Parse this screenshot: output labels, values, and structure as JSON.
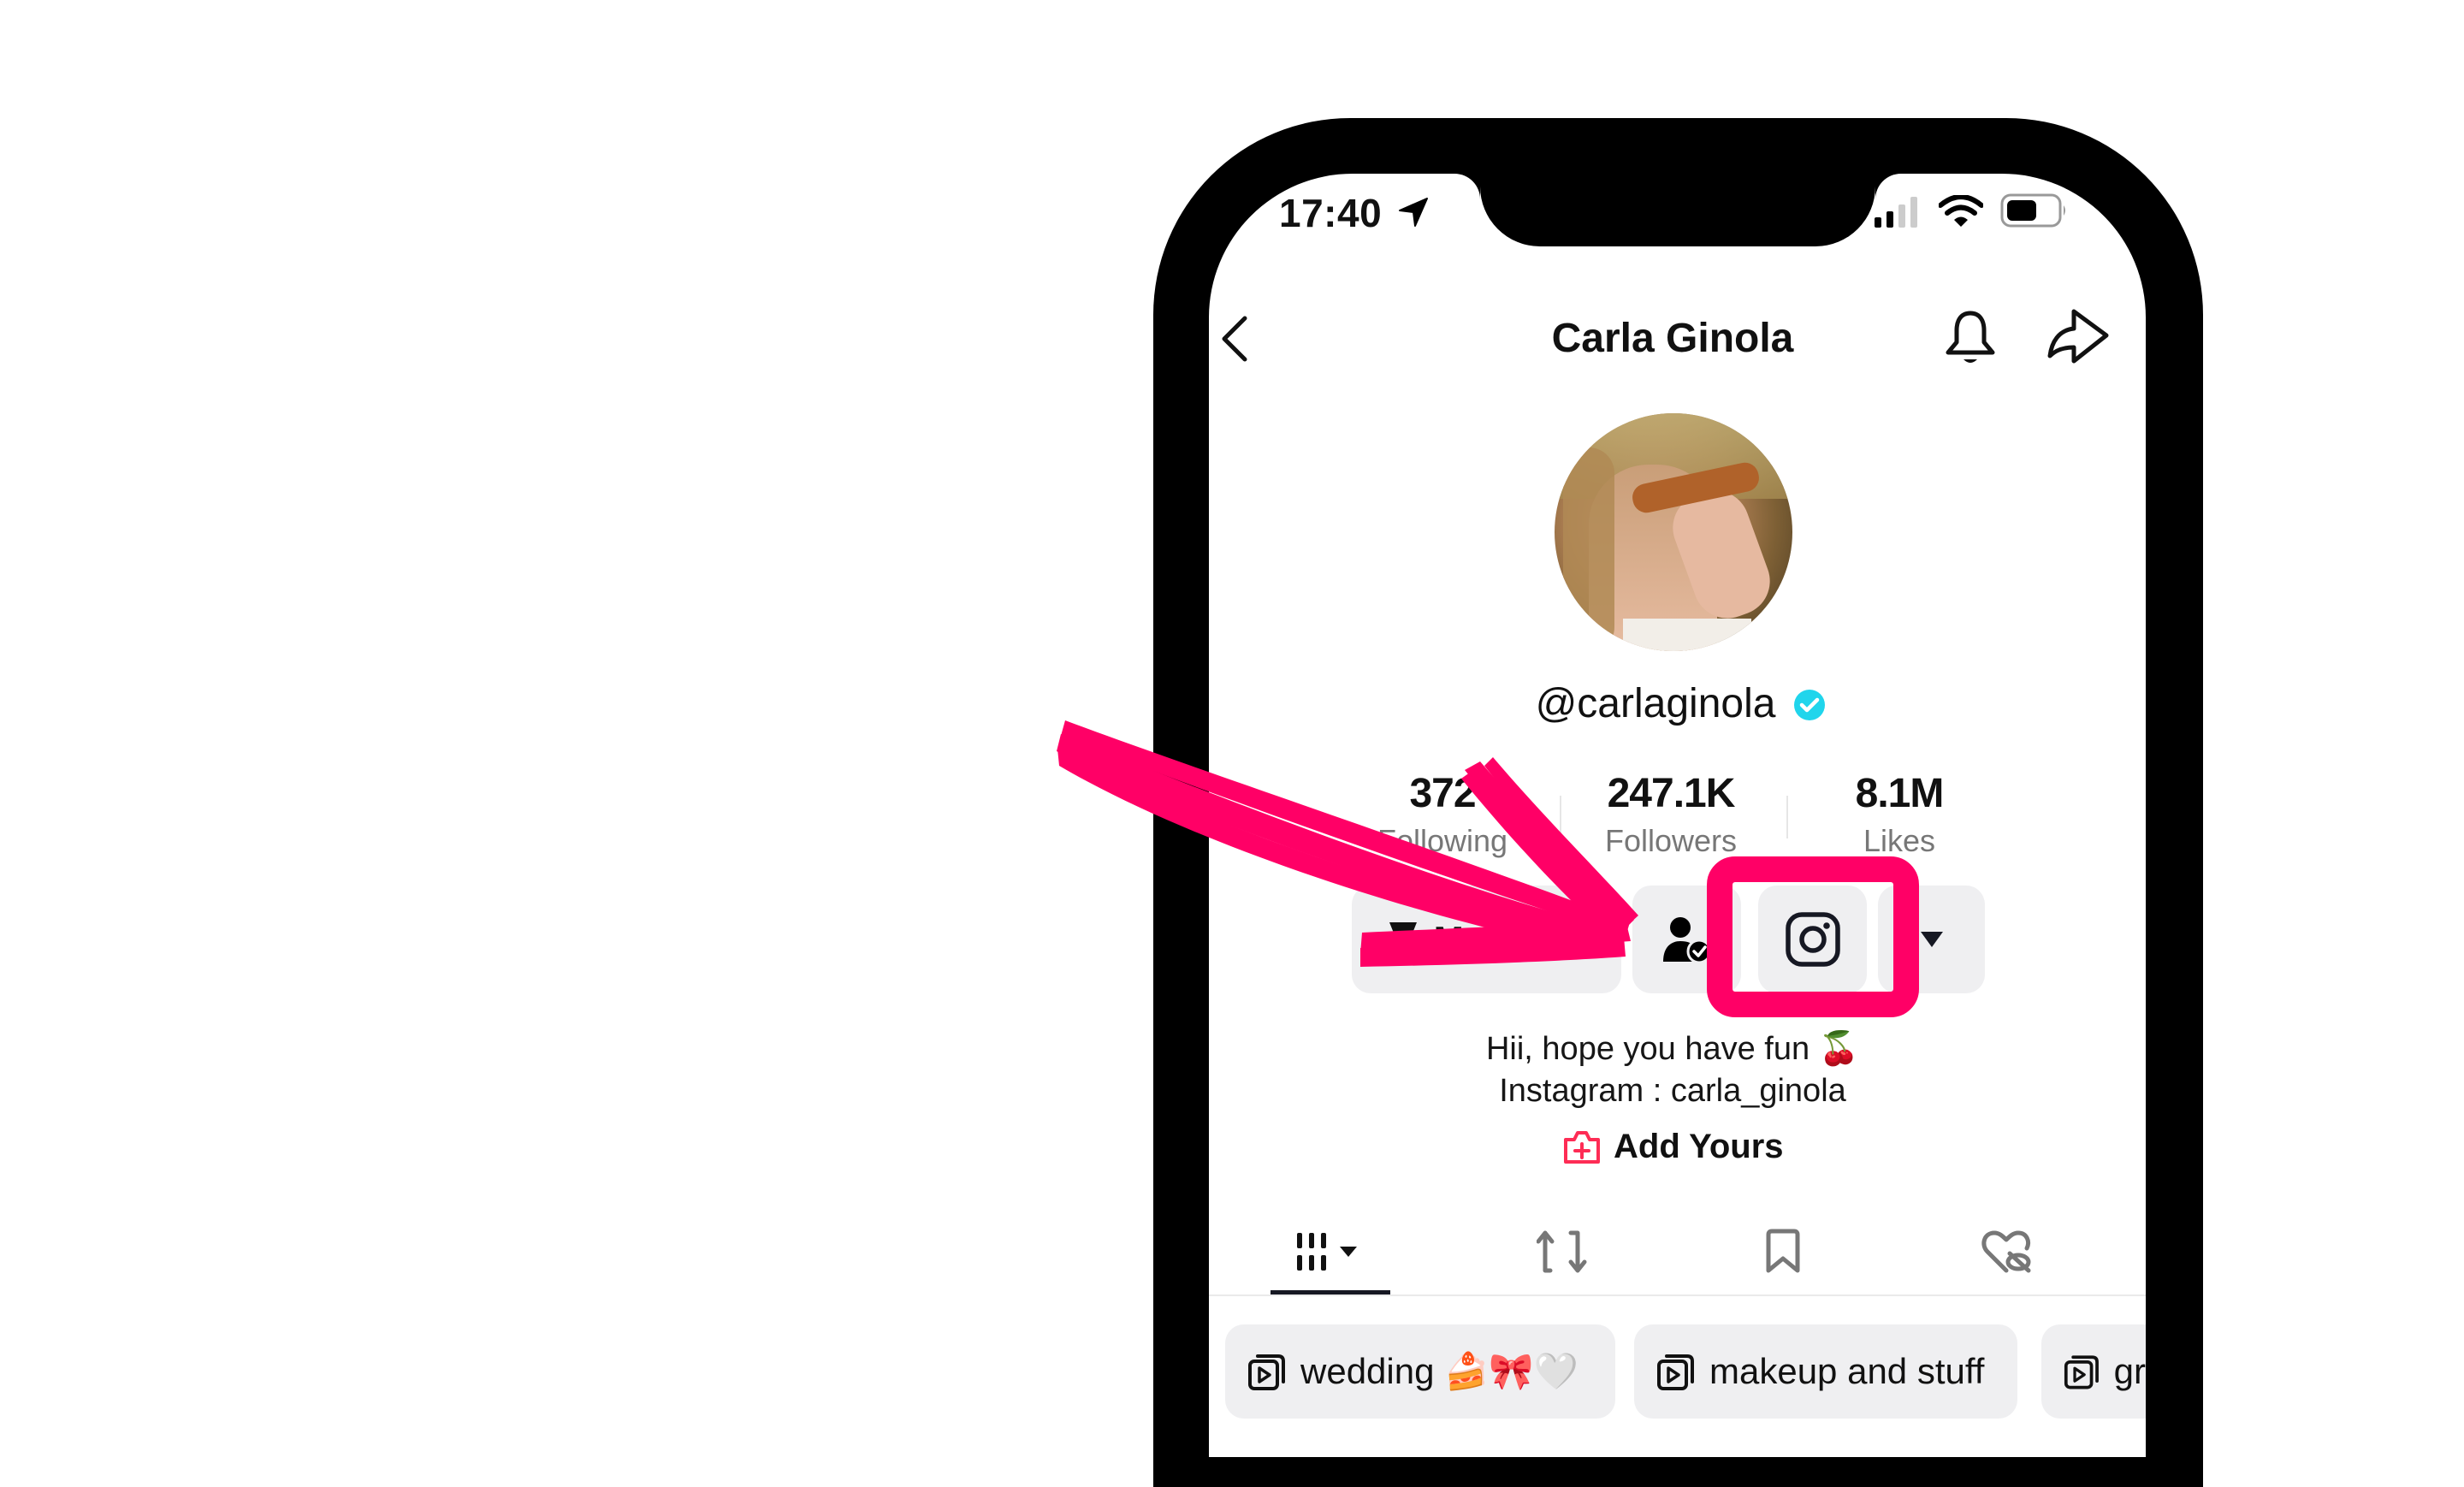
{
  "status_bar": {
    "time": "17:40",
    "location_icon": "location-arrow-icon",
    "signal_icon": "cellular-signal-icon",
    "wifi_icon": "wifi-icon",
    "battery_icon": "battery-icon"
  },
  "header": {
    "title": "Carla Ginola",
    "back_icon": "chevron-left-icon",
    "bell_icon": "bell-icon",
    "share_icon": "share-arrow-icon"
  },
  "profile": {
    "avatar": "avatar-photo",
    "handle": "@carlaginola",
    "verified": true,
    "verified_color": "#20D5EC",
    "stats": [
      {
        "value": "372",
        "label": "Following"
      },
      {
        "value": "247.1K",
        "label": "Followers"
      },
      {
        "value": "8.1M",
        "label": "Likes"
      }
    ],
    "buttons": {
      "message_label": "Message",
      "follow_icon": "user-check-icon",
      "instagram_icon": "instagram-icon",
      "more_icon": "caret-down-icon"
    },
    "bio": [
      "Hii, hope you have fun 🍒",
      "Instagram : carla_ginola"
    ],
    "add_yours_label": "Add Yours",
    "add_yours_color": "#FE2C55"
  },
  "tabs": [
    {
      "name": "videos",
      "icon": "grid-icon",
      "active": true
    },
    {
      "name": "reposts",
      "icon": "repost-icon",
      "active": false
    },
    {
      "name": "favorites",
      "icon": "bookmark-icon",
      "active": false
    },
    {
      "name": "liked",
      "icon": "heart-hidden-icon",
      "active": false
    }
  ],
  "playlists": [
    {
      "label": "wedding 🍰🎀🤍"
    },
    {
      "label": "makeup and stuff"
    },
    {
      "label": "gr"
    }
  ],
  "annotation": {
    "color": "#FF0066",
    "highlight": "instagram-button"
  }
}
